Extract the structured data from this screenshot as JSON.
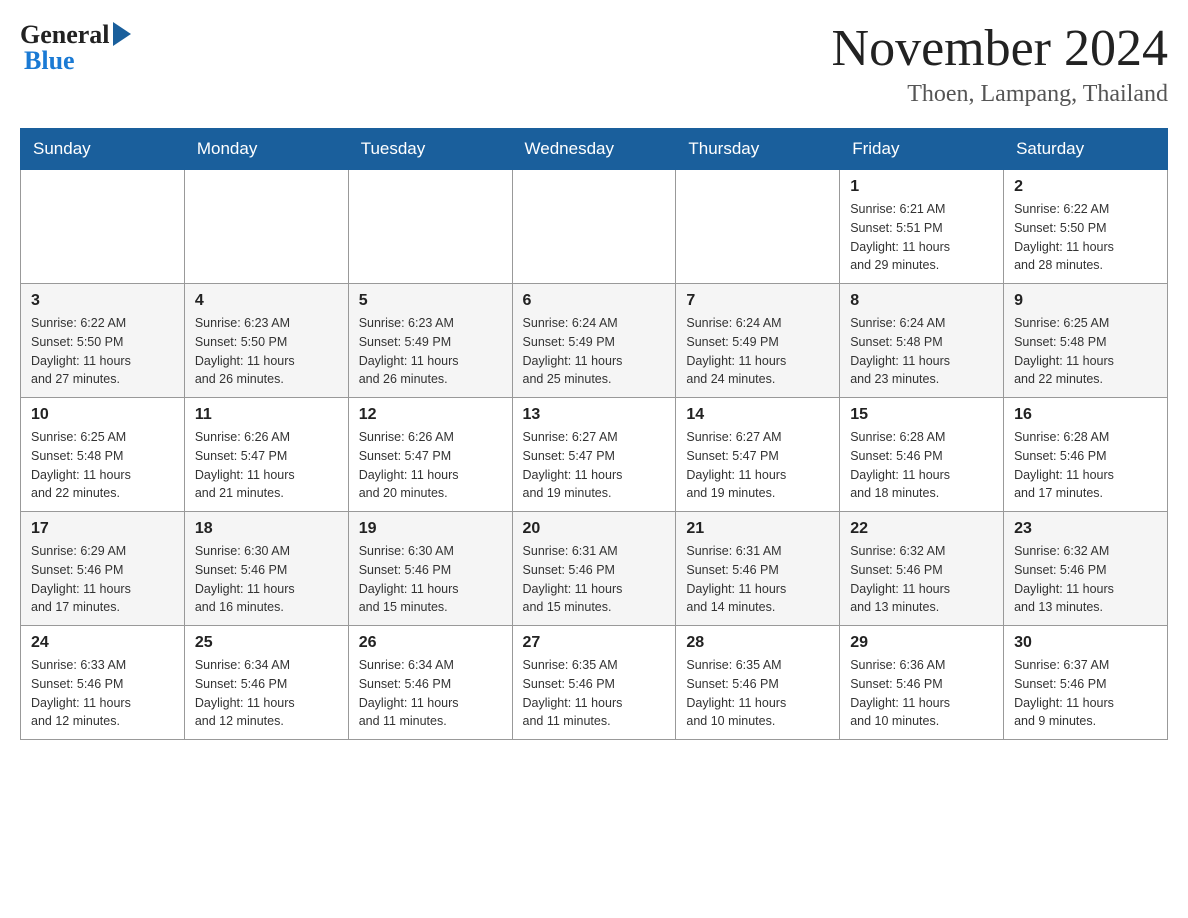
{
  "logo": {
    "general": "General",
    "blue": "Blue"
  },
  "header": {
    "month": "November 2024",
    "location": "Thoen, Lampang, Thailand"
  },
  "weekdays": [
    "Sunday",
    "Monday",
    "Tuesday",
    "Wednesday",
    "Thursday",
    "Friday",
    "Saturday"
  ],
  "weeks": [
    [
      {
        "day": "",
        "info": ""
      },
      {
        "day": "",
        "info": ""
      },
      {
        "day": "",
        "info": ""
      },
      {
        "day": "",
        "info": ""
      },
      {
        "day": "",
        "info": ""
      },
      {
        "day": "1",
        "info": "Sunrise: 6:21 AM\nSunset: 5:51 PM\nDaylight: 11 hours\nand 29 minutes."
      },
      {
        "day": "2",
        "info": "Sunrise: 6:22 AM\nSunset: 5:50 PM\nDaylight: 11 hours\nand 28 minutes."
      }
    ],
    [
      {
        "day": "3",
        "info": "Sunrise: 6:22 AM\nSunset: 5:50 PM\nDaylight: 11 hours\nand 27 minutes."
      },
      {
        "day": "4",
        "info": "Sunrise: 6:23 AM\nSunset: 5:50 PM\nDaylight: 11 hours\nand 26 minutes."
      },
      {
        "day": "5",
        "info": "Sunrise: 6:23 AM\nSunset: 5:49 PM\nDaylight: 11 hours\nand 26 minutes."
      },
      {
        "day": "6",
        "info": "Sunrise: 6:24 AM\nSunset: 5:49 PM\nDaylight: 11 hours\nand 25 minutes."
      },
      {
        "day": "7",
        "info": "Sunrise: 6:24 AM\nSunset: 5:49 PM\nDaylight: 11 hours\nand 24 minutes."
      },
      {
        "day": "8",
        "info": "Sunrise: 6:24 AM\nSunset: 5:48 PM\nDaylight: 11 hours\nand 23 minutes."
      },
      {
        "day": "9",
        "info": "Sunrise: 6:25 AM\nSunset: 5:48 PM\nDaylight: 11 hours\nand 22 minutes."
      }
    ],
    [
      {
        "day": "10",
        "info": "Sunrise: 6:25 AM\nSunset: 5:48 PM\nDaylight: 11 hours\nand 22 minutes."
      },
      {
        "day": "11",
        "info": "Sunrise: 6:26 AM\nSunset: 5:47 PM\nDaylight: 11 hours\nand 21 minutes."
      },
      {
        "day": "12",
        "info": "Sunrise: 6:26 AM\nSunset: 5:47 PM\nDaylight: 11 hours\nand 20 minutes."
      },
      {
        "day": "13",
        "info": "Sunrise: 6:27 AM\nSunset: 5:47 PM\nDaylight: 11 hours\nand 19 minutes."
      },
      {
        "day": "14",
        "info": "Sunrise: 6:27 AM\nSunset: 5:47 PM\nDaylight: 11 hours\nand 19 minutes."
      },
      {
        "day": "15",
        "info": "Sunrise: 6:28 AM\nSunset: 5:46 PM\nDaylight: 11 hours\nand 18 minutes."
      },
      {
        "day": "16",
        "info": "Sunrise: 6:28 AM\nSunset: 5:46 PM\nDaylight: 11 hours\nand 17 minutes."
      }
    ],
    [
      {
        "day": "17",
        "info": "Sunrise: 6:29 AM\nSunset: 5:46 PM\nDaylight: 11 hours\nand 17 minutes."
      },
      {
        "day": "18",
        "info": "Sunrise: 6:30 AM\nSunset: 5:46 PM\nDaylight: 11 hours\nand 16 minutes."
      },
      {
        "day": "19",
        "info": "Sunrise: 6:30 AM\nSunset: 5:46 PM\nDaylight: 11 hours\nand 15 minutes."
      },
      {
        "day": "20",
        "info": "Sunrise: 6:31 AM\nSunset: 5:46 PM\nDaylight: 11 hours\nand 15 minutes."
      },
      {
        "day": "21",
        "info": "Sunrise: 6:31 AM\nSunset: 5:46 PM\nDaylight: 11 hours\nand 14 minutes."
      },
      {
        "day": "22",
        "info": "Sunrise: 6:32 AM\nSunset: 5:46 PM\nDaylight: 11 hours\nand 13 minutes."
      },
      {
        "day": "23",
        "info": "Sunrise: 6:32 AM\nSunset: 5:46 PM\nDaylight: 11 hours\nand 13 minutes."
      }
    ],
    [
      {
        "day": "24",
        "info": "Sunrise: 6:33 AM\nSunset: 5:46 PM\nDaylight: 11 hours\nand 12 minutes."
      },
      {
        "day": "25",
        "info": "Sunrise: 6:34 AM\nSunset: 5:46 PM\nDaylight: 11 hours\nand 12 minutes."
      },
      {
        "day": "26",
        "info": "Sunrise: 6:34 AM\nSunset: 5:46 PM\nDaylight: 11 hours\nand 11 minutes."
      },
      {
        "day": "27",
        "info": "Sunrise: 6:35 AM\nSunset: 5:46 PM\nDaylight: 11 hours\nand 11 minutes."
      },
      {
        "day": "28",
        "info": "Sunrise: 6:35 AM\nSunset: 5:46 PM\nDaylight: 11 hours\nand 10 minutes."
      },
      {
        "day": "29",
        "info": "Sunrise: 6:36 AM\nSunset: 5:46 PM\nDaylight: 11 hours\nand 10 minutes."
      },
      {
        "day": "30",
        "info": "Sunrise: 6:37 AM\nSunset: 5:46 PM\nDaylight: 11 hours\nand 9 minutes."
      }
    ]
  ]
}
